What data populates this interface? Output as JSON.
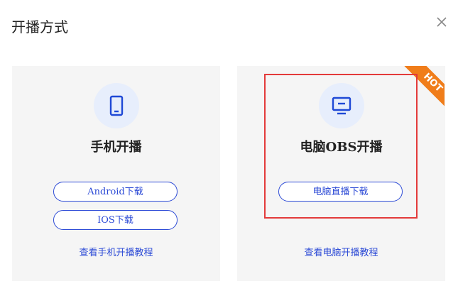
{
  "dialog": {
    "title": "开播方式",
    "close_icon": "close-icon"
  },
  "cards": [
    {
      "icon": "phone-icon",
      "title": "手机开播",
      "buttons": [
        "Android下载",
        "IOS下载"
      ],
      "link": "查看手机开播教程"
    },
    {
      "icon": "monitor-icon",
      "title": "电脑OBS开播",
      "buttons": [
        "电脑直播下载"
      ],
      "link": "查看电脑开播教程",
      "badge": "HOT"
    }
  ],
  "colors": {
    "accent": "#2d4bd6",
    "badge": "#f07d1a",
    "highlight": "#e33a3a",
    "card_bg": "#f5f5f5"
  }
}
